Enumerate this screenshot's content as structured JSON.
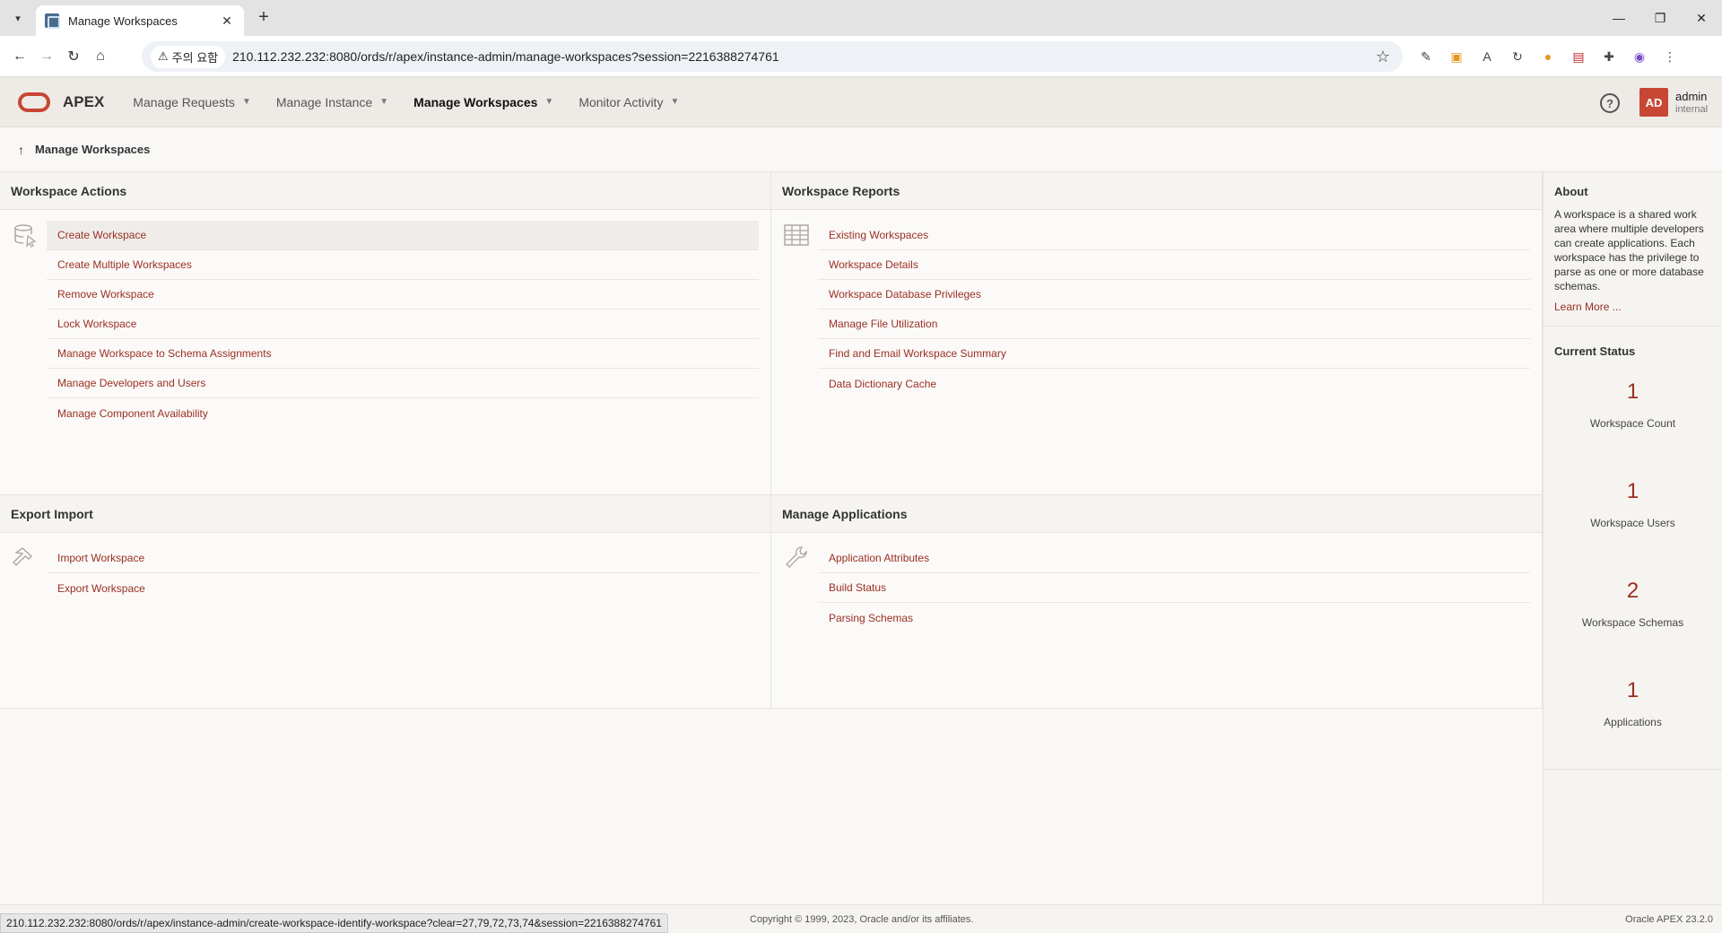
{
  "browser": {
    "tab_title": "Manage Workspaces",
    "security_label": "주의 요함",
    "url": "210.112.232.232:8080/ords/r/apex/instance-admin/manage-workspaces?session=2216388274761",
    "status_url": "210.112.232.232:8080/ords/r/apex/instance-admin/create-workspace-identify-workspace?clear=27,79,72,73,74&session=2216388274761"
  },
  "header": {
    "app_name": "APEX",
    "menu": [
      {
        "label": "Manage Requests"
      },
      {
        "label": "Manage Instance"
      },
      {
        "label": "Manage Workspaces"
      },
      {
        "label": "Monitor Activity"
      }
    ],
    "user": {
      "initials": "AD",
      "name": "admin",
      "sub": "internal"
    }
  },
  "breadcrumb": {
    "current": "Manage Workspaces"
  },
  "regions": {
    "workspace_actions": {
      "title": "Workspace Actions",
      "links": [
        "Create Workspace",
        "Create Multiple Workspaces",
        "Remove Workspace",
        "Lock Workspace",
        "Manage Workspace to Schema Assignments",
        "Manage Developers and Users",
        "Manage Component Availability"
      ]
    },
    "workspace_reports": {
      "title": "Workspace Reports",
      "links": [
        "Existing Workspaces",
        "Workspace Details",
        "Workspace Database Privileges",
        "Manage File Utilization",
        "Find and Email Workspace Summary",
        "Data Dictionary Cache"
      ]
    },
    "export_import": {
      "title": "Export Import",
      "links": [
        "Import Workspace",
        "Export Workspace"
      ]
    },
    "manage_applications": {
      "title": "Manage Applications",
      "links": [
        "Application Attributes",
        "Build Status",
        "Parsing Schemas"
      ]
    }
  },
  "side": {
    "about_title": "About",
    "about_text": "A workspace is a shared work area where multiple developers can create applications. Each workspace has the privilege to parse as one or more database schemas.",
    "learn_more": "Learn More ...",
    "status_title": "Current Status",
    "stats": [
      {
        "value": "1",
        "label": "Workspace Count"
      },
      {
        "value": "1",
        "label": "Workspace Users"
      },
      {
        "value": "2",
        "label": "Workspace Schemas"
      },
      {
        "value": "1",
        "label": "Applications"
      }
    ]
  },
  "footer": {
    "copyright": "Copyright © 1999, 2023, Oracle and/or its affiliates.",
    "version": "Oracle APEX 23.2.0"
  }
}
